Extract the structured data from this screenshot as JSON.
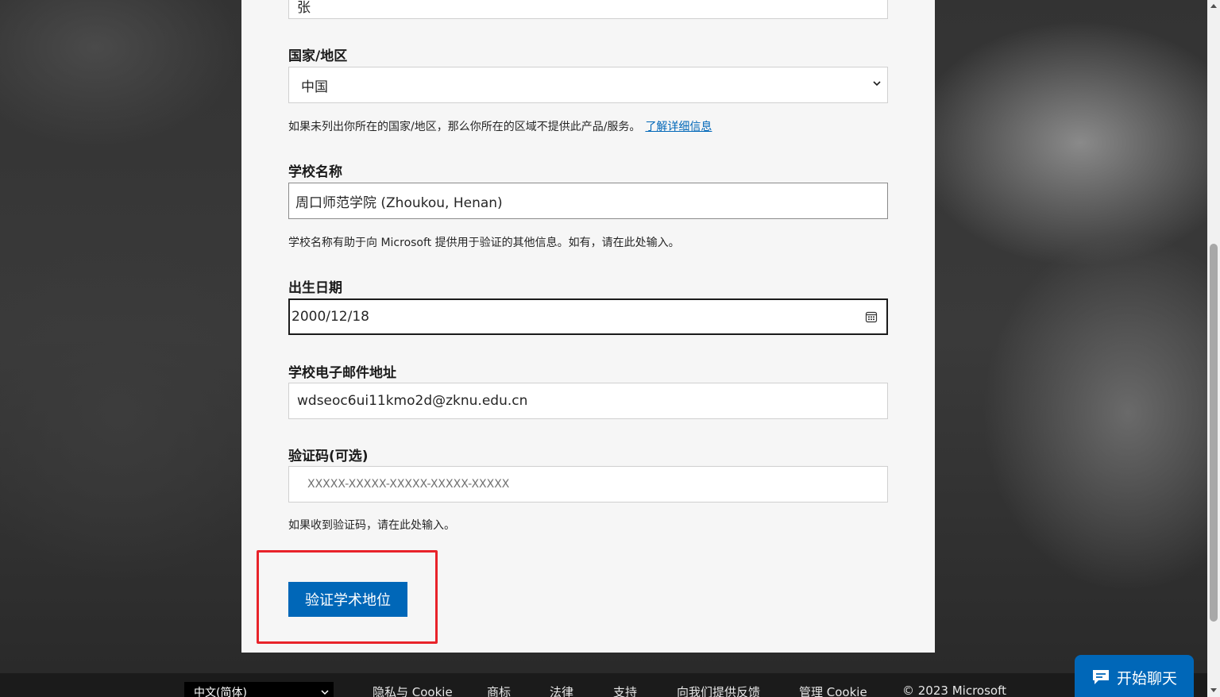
{
  "form": {
    "name_value": "张",
    "country": {
      "label": "国家/地区",
      "value": "中国",
      "help": "如果未列出你所在的国家/地区，那么你所在的区域不提供此产品/服务。",
      "help_link": "了解详细信息"
    },
    "school": {
      "label": "学校名称",
      "value": "周口师范学院 (Zhoukou, Henan)",
      "help": "学校名称有助于向 Microsoft 提供用于验证的其他信息。如有，请在此处输入。"
    },
    "birthdate": {
      "label": "出生日期",
      "value": "2000/12/18"
    },
    "school_email": {
      "label": "学校电子邮件地址",
      "value": "wdseoc6ui11kmo2d@zknu.edu.cn"
    },
    "code": {
      "label": "验证码(可选)",
      "placeholder": "XXXXX-XXXXX-XXXXX-XXXXX-XXXXX",
      "help": "如果收到验证码，请在此处输入。"
    },
    "submit_label": "验证学术地位"
  },
  "footer": {
    "language": "中文(简体)",
    "links": [
      "隐私与 Cookie",
      "商标",
      "法律",
      "支持",
      "向我们提供反馈",
      "管理 Cookie",
      "© 2023 Microsoft"
    ]
  },
  "chat": {
    "label": "开始聊天"
  },
  "colors": {
    "accent": "#0067b8",
    "highlight": "#e8232a"
  }
}
